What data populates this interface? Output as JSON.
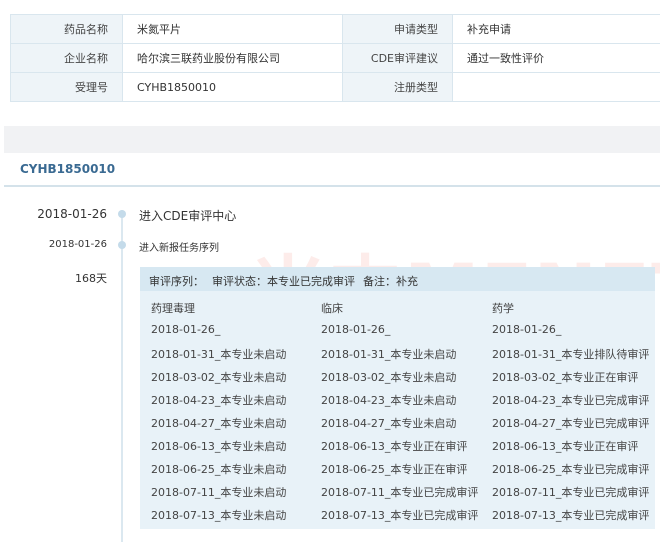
{
  "info": {
    "drug_name_label": "药品名称",
    "drug_name_value": "米氮平片",
    "apply_type_label": "申请类型",
    "apply_type_value": "补充申请",
    "company_label": "企业名称",
    "company_value": "哈尔滨三联药业股份有限公司",
    "cde_label": "CDE审评建议",
    "cde_value": "通过一致性评价",
    "accept_no_label": "受理号",
    "accept_no_value": "CYHB1850010",
    "reg_type_label": "注册类型",
    "reg_type_value": ""
  },
  "section_code": "CYHB1850010",
  "timeline": [
    {
      "date": "2018-01-26",
      "text": "进入CDE审评中心"
    },
    {
      "date": "2018-01-26",
      "text": "进入新报任务序列"
    },
    {
      "date": "168天",
      "text": ""
    }
  ],
  "watermark": "米内MENET",
  "review": {
    "seq_label": "审评序列：",
    "status_label": "审评状态：本专业已完成审评",
    "note_label": "备注：补充",
    "columns": [
      "药理毒理",
      "临床",
      "药学"
    ],
    "rows": [
      [
        "2018-01-26_",
        "2018-01-26_",
        "2018-01-26_"
      ],
      [
        "2018-01-31_本专业未启动",
        "2018-01-31_本专业未启动",
        "2018-01-31_本专业排队待审评"
      ],
      [
        "2018-03-02_本专业未启动",
        "2018-03-02_本专业未启动",
        "2018-03-02_本专业正在审评"
      ],
      [
        "2018-04-23_本专业未启动",
        "2018-04-23_本专业未启动",
        "2018-04-23_本专业已完成审评"
      ],
      [
        "2018-04-27_本专业未启动",
        "2018-04-27_本专业未启动",
        "2018-04-27_本专业已完成审评"
      ],
      [
        "2018-06-13_本专业未启动",
        "2018-06-13_本专业正在审评",
        "2018-06-13_本专业正在审评"
      ],
      [
        "2018-06-25_本专业未启动",
        "2018-06-25_本专业正在审评",
        "2018-06-25_本专业已完成审评"
      ],
      [
        "2018-07-11_本专业未启动",
        "2018-07-11_本专业已完成审评",
        "2018-07-11_本专业已完成审评"
      ],
      [
        "2018-07-13_本专业未启动",
        "2018-07-13_本专业已完成审评",
        "2018-07-13_本专业已完成审评"
      ]
    ]
  }
}
